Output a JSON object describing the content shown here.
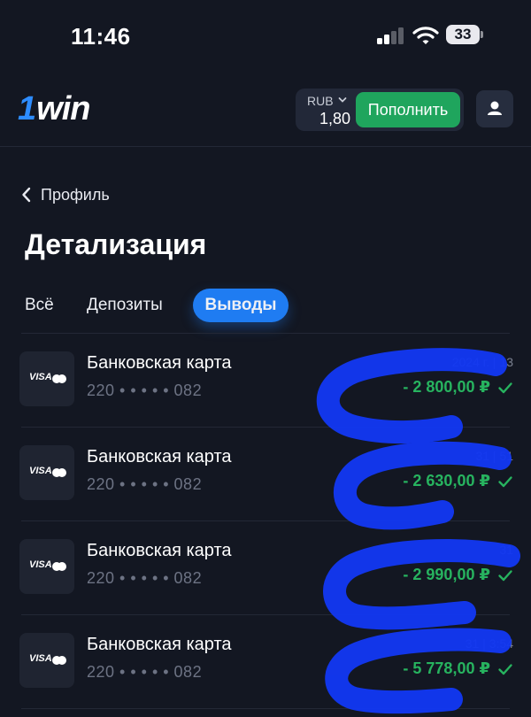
{
  "status_bar": {
    "time": "11:46",
    "battery": "33"
  },
  "header": {
    "currency": "RUB",
    "balance": "1,80",
    "deposit_label": "Пополнить"
  },
  "nav": {
    "back_label": "Профиль"
  },
  "page": {
    "title": "Детализация"
  },
  "tabs": [
    {
      "label": "Всё",
      "active": false
    },
    {
      "label": "Депозиты",
      "active": false
    },
    {
      "label": "Выводы",
      "active": true
    }
  ],
  "transactions": [
    {
      "title": "Банковская карта",
      "card_mask": "220 • • • • • 082",
      "date_visible": "2024 г. | 13",
      "amount": "- 2 800,00 ₽"
    },
    {
      "title": "Банковская карта",
      "card_mask": "220 • • • • • 082",
      "date_visible": "31 | 51",
      "amount": "- 2 630,00 ₽"
    },
    {
      "title": "Банковская карта",
      "card_mask": "220 • • • • • 082",
      "date_visible": "31",
      "amount": "- 2 990,00 ₽"
    },
    {
      "title": "Банковская карта",
      "card_mask": "220 • • • • • 082",
      "date_visible": "31 | 3:54",
      "amount": "- 5 778,00 ₽"
    }
  ],
  "card_brand": "VISA",
  "colors": {
    "background": "#131722",
    "accent_blue": "#1f7cf2",
    "deposit_green": "#1fa55d",
    "amount_green": "#27b35f",
    "scribble_blue": "#1238f2"
  }
}
